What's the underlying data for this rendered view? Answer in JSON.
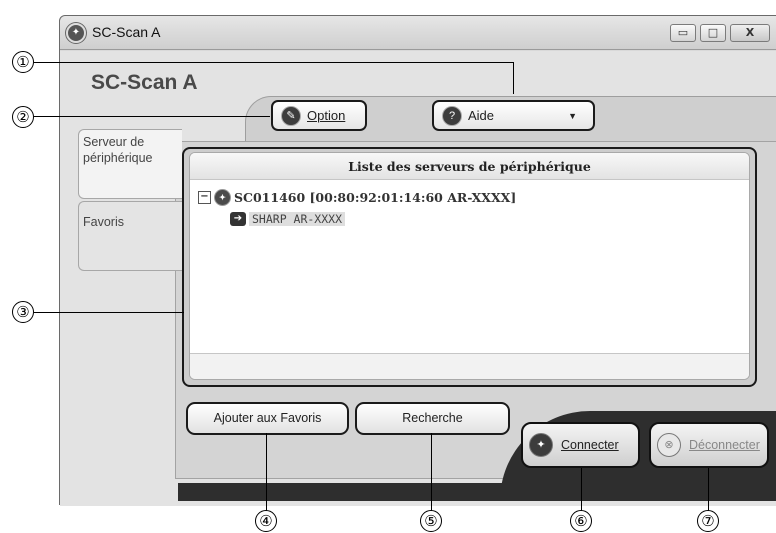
{
  "window": {
    "title": "SC-Scan A",
    "controls": [
      "minimize-icon",
      "maximize-icon",
      "close-icon"
    ],
    "min_glyph": "▭",
    "max_glyph": "□",
    "close_glyph": "X"
  },
  "app": {
    "name": "SC-Scan A"
  },
  "toolbar": {
    "option_label": "Option",
    "aide_label": "Aide",
    "aide_caret": "▼"
  },
  "tabs": [
    {
      "label": "Serveur de périphérique",
      "line1": "Serveur de",
      "line2": "périphérique",
      "active": true
    },
    {
      "label": "Favoris",
      "active": false
    }
  ],
  "list": {
    "header": "Liste des serveurs de périphérique",
    "server": {
      "expander": "−",
      "label": "SC011460 [00:80:92:01:14:60 AR-XXXX]"
    },
    "device": {
      "label": "SHARP AR-XXXX",
      "selected": true
    }
  },
  "buttons": {
    "add_favorite": "Ajouter aux Favoris",
    "search": "Recherche",
    "connect": "Connecter",
    "disconnect": "Déconnecter",
    "disconnect_enabled": false
  },
  "callouts": [
    "①",
    "②",
    "③",
    "④",
    "⑤",
    "⑥",
    "⑦"
  ]
}
